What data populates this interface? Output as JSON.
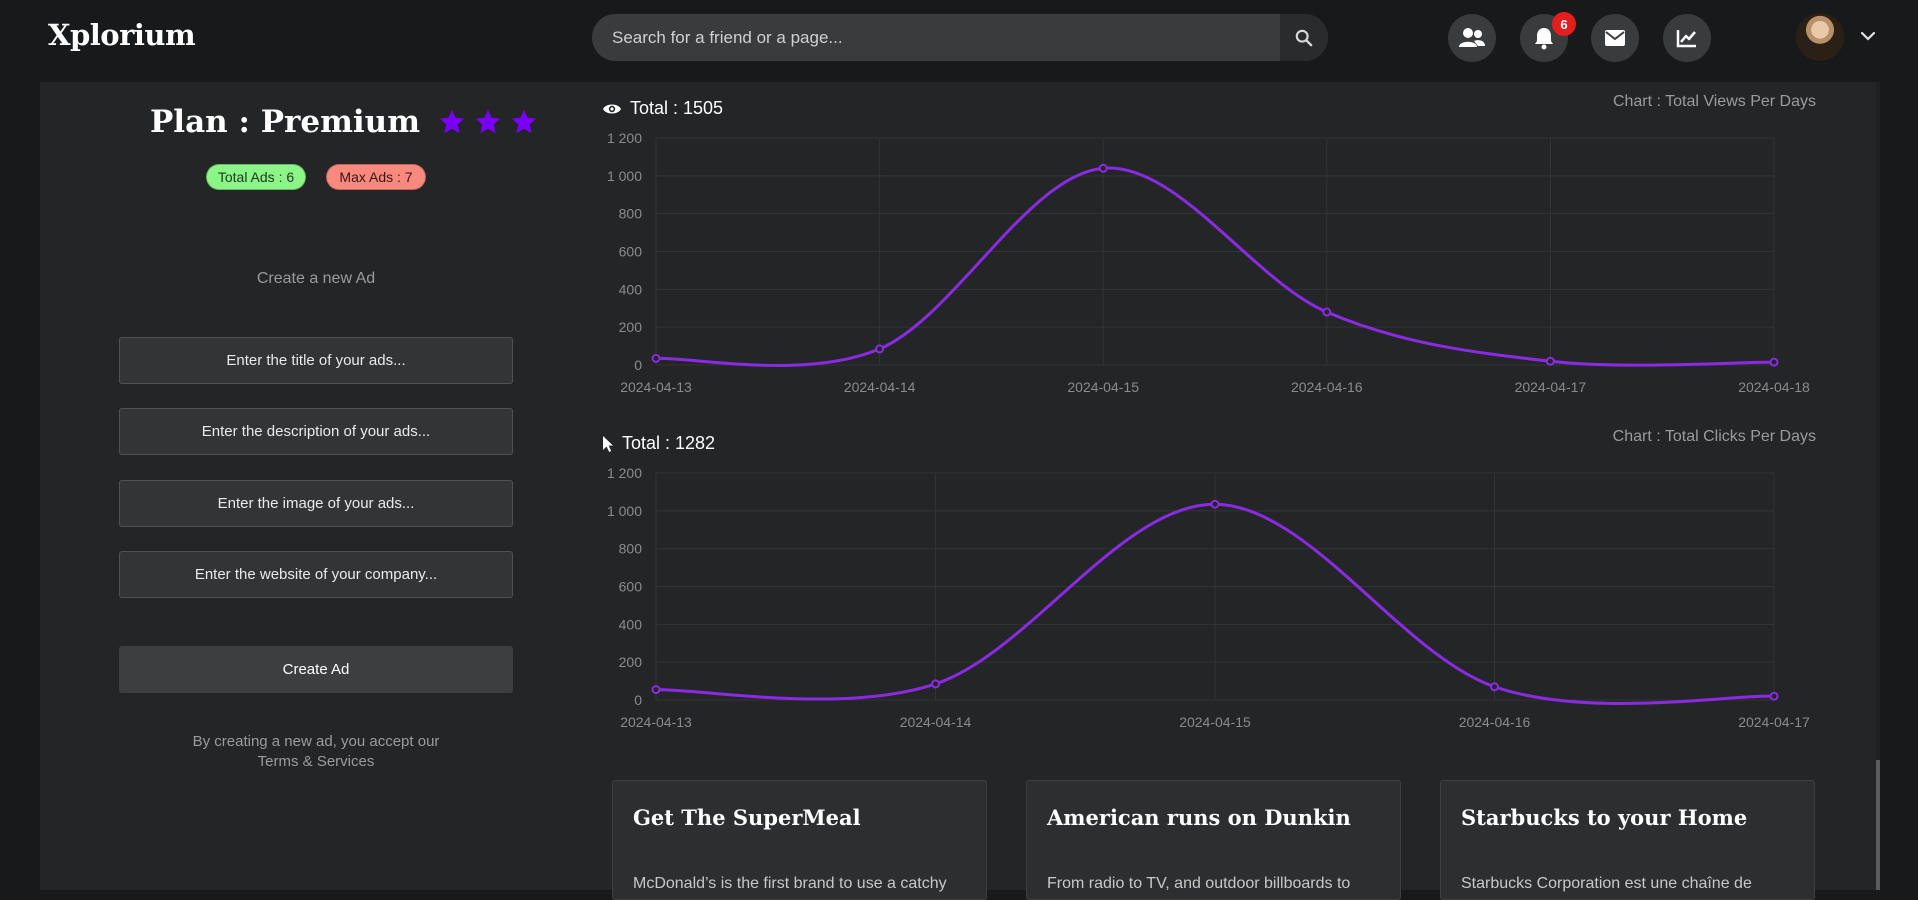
{
  "nav": {
    "logo": "Xplorium",
    "search_placeholder": "Search for a friend or a page...",
    "notification_count": "6",
    "icons": [
      "friends-icon",
      "bell-icon",
      "envelope-icon",
      "chart-line-icon",
      "chevron-down-icon"
    ]
  },
  "plan": {
    "title": "Plan : Premium",
    "stars": 3,
    "star_color": "#7a00f5",
    "total_ads": "Total Ads : 6",
    "max_ads": "Max Ads : 7"
  },
  "form": {
    "heading": "Create a new Ad",
    "title_placeholder": "Enter the title of your ads...",
    "description_placeholder": "Enter the description of your ads...",
    "image_placeholder": "Enter the image of your ads...",
    "website_placeholder": "Enter the website of your company...",
    "submit_label": "Create Ad",
    "terms_text": "By creating a new ad, you accept our",
    "terms_link": "Terms & Services"
  },
  "chart_data": [
    {
      "type": "line",
      "title": "Chart : Total Views Per Days",
      "total_label": "Total : 1505",
      "x": [
        "2024-04-13",
        "2024-04-14",
        "2024-04-15",
        "2024-04-16",
        "2024-04-17",
        "2024-04-18"
      ],
      "y": [
        35,
        85,
        1040,
        280,
        20,
        15
      ],
      "ylim": [
        0,
        1200
      ],
      "yticks": [
        "0",
        "200",
        "400",
        "600",
        "800",
        "1 000",
        "1 200"
      ],
      "color": "#8a2be2",
      "grid": true
    },
    {
      "type": "line",
      "title": "Chart : Total Clicks Per Days",
      "total_label": "Total : 1282",
      "x": [
        "2024-04-13",
        "2024-04-14",
        "2024-04-15",
        "2024-04-16",
        "2024-04-17"
      ],
      "y": [
        55,
        85,
        1035,
        70,
        20
      ],
      "ylim": [
        0,
        1200
      ],
      "yticks": [
        "0",
        "200",
        "400",
        "600",
        "800",
        "1 000",
        "1 200"
      ],
      "color": "#8a2be2",
      "grid": true
    }
  ],
  "cards": [
    {
      "title": "Get The SuperMeal",
      "description": "McDonald’s is the first brand to use a catchy"
    },
    {
      "title": "American runs on Dunkin",
      "description": "From radio to TV, and outdoor billboards to"
    },
    {
      "title": "Starbucks to your Home",
      "description": "Starbucks Corporation est une chaîne de"
    }
  ]
}
